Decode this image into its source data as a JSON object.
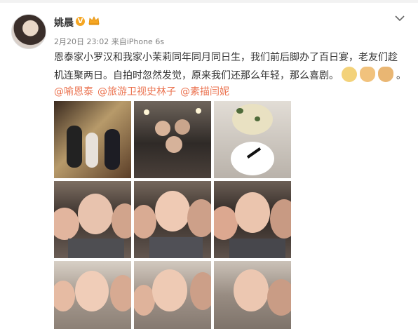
{
  "post": {
    "user_name": "姚晨",
    "verified_badge": "V",
    "meta": "2月20日 23:02 来自iPhone 6s",
    "text_line1": "恩泰家小罗汉和我家小茉莉同年同月同日生，我们前后脚办了百日宴，老友们趁",
    "text_line2": "机连聚两日。自拍时忽然发觉，原来我们还那么年轻，那么喜剧。",
    "text_end": "。",
    "mentions": [
      "@喻恩泰",
      "@旅游卫视史林子",
      "@素描闫妮"
    ],
    "icons": {
      "avatar": "user-avatar",
      "crown": "vip-crown-icon",
      "menu": "chevron-down-icon",
      "emoji1": "dog-face-emoji",
      "emoji2": "clapping-hands-emoji",
      "emoji3": "rock-hand-emoji"
    },
    "colors": {
      "mention": "#eb7350",
      "meta": "#808080",
      "text": "#333333",
      "badge": "#f5a623"
    }
  },
  "photos": [
    {
      "name": "photo-stage-family",
      "bg": "#6b4a2f"
    },
    {
      "name": "photo-group-dinner",
      "bg": "#3b3531"
    },
    {
      "name": "photo-cookies",
      "bg": "#cfc9c3"
    },
    {
      "name": "photo-selfie-1",
      "bg": "#8a7a6f"
    },
    {
      "name": "photo-selfie-2",
      "bg": "#7c6c63"
    },
    {
      "name": "photo-selfie-3",
      "bg": "#6f6259"
    },
    {
      "name": "photo-selfie-4",
      "bg": "#b3a69b"
    },
    {
      "name": "photo-selfie-5",
      "bg": "#a89a8f"
    },
    {
      "name": "photo-selfie-6",
      "bg": "#9d9086"
    }
  ]
}
